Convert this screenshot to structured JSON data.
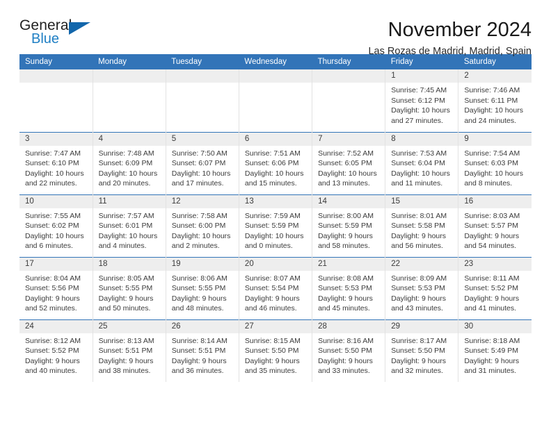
{
  "brand": {
    "name_top": "General",
    "name_bottom": "Blue",
    "accent_color": "#1266ab",
    "blue_text_color": "#1f7fc4",
    "triangle_icon": "triangle-icon"
  },
  "header": {
    "title": "November 2024",
    "subtitle": "Las Rozas de Madrid, Madrid, Spain"
  },
  "calendar": {
    "header_bg": "#3274b8",
    "daynum_bg": "#eeeeee",
    "weekday_labels": [
      "Sunday",
      "Monday",
      "Tuesday",
      "Wednesday",
      "Thursday",
      "Friday",
      "Saturday"
    ],
    "labels": {
      "sunrise": "Sunrise:",
      "sunset": "Sunset:",
      "daylight": "Daylight:"
    },
    "weeks": [
      [
        {
          "day": ""
        },
        {
          "day": ""
        },
        {
          "day": ""
        },
        {
          "day": ""
        },
        {
          "day": ""
        },
        {
          "day": "1",
          "sunrise": "Sunrise: 7:45 AM",
          "sunset": "Sunset: 6:12 PM",
          "daylight_1": "Daylight: 10 hours",
          "daylight_2": "and 27 minutes."
        },
        {
          "day": "2",
          "sunrise": "Sunrise: 7:46 AM",
          "sunset": "Sunset: 6:11 PM",
          "daylight_1": "Daylight: 10 hours",
          "daylight_2": "and 24 minutes."
        }
      ],
      [
        {
          "day": "3",
          "sunrise": "Sunrise: 7:47 AM",
          "sunset": "Sunset: 6:10 PM",
          "daylight_1": "Daylight: 10 hours",
          "daylight_2": "and 22 minutes."
        },
        {
          "day": "4",
          "sunrise": "Sunrise: 7:48 AM",
          "sunset": "Sunset: 6:09 PM",
          "daylight_1": "Daylight: 10 hours",
          "daylight_2": "and 20 minutes."
        },
        {
          "day": "5",
          "sunrise": "Sunrise: 7:50 AM",
          "sunset": "Sunset: 6:07 PM",
          "daylight_1": "Daylight: 10 hours",
          "daylight_2": "and 17 minutes."
        },
        {
          "day": "6",
          "sunrise": "Sunrise: 7:51 AM",
          "sunset": "Sunset: 6:06 PM",
          "daylight_1": "Daylight: 10 hours",
          "daylight_2": "and 15 minutes."
        },
        {
          "day": "7",
          "sunrise": "Sunrise: 7:52 AM",
          "sunset": "Sunset: 6:05 PM",
          "daylight_1": "Daylight: 10 hours",
          "daylight_2": "and 13 minutes."
        },
        {
          "day": "8",
          "sunrise": "Sunrise: 7:53 AM",
          "sunset": "Sunset: 6:04 PM",
          "daylight_1": "Daylight: 10 hours",
          "daylight_2": "and 11 minutes."
        },
        {
          "day": "9",
          "sunrise": "Sunrise: 7:54 AM",
          "sunset": "Sunset: 6:03 PM",
          "daylight_1": "Daylight: 10 hours",
          "daylight_2": "and 8 minutes."
        }
      ],
      [
        {
          "day": "10",
          "sunrise": "Sunrise: 7:55 AM",
          "sunset": "Sunset: 6:02 PM",
          "daylight_1": "Daylight: 10 hours",
          "daylight_2": "and 6 minutes."
        },
        {
          "day": "11",
          "sunrise": "Sunrise: 7:57 AM",
          "sunset": "Sunset: 6:01 PM",
          "daylight_1": "Daylight: 10 hours",
          "daylight_2": "and 4 minutes."
        },
        {
          "day": "12",
          "sunrise": "Sunrise: 7:58 AM",
          "sunset": "Sunset: 6:00 PM",
          "daylight_1": "Daylight: 10 hours",
          "daylight_2": "and 2 minutes."
        },
        {
          "day": "13",
          "sunrise": "Sunrise: 7:59 AM",
          "sunset": "Sunset: 5:59 PM",
          "daylight_1": "Daylight: 10 hours",
          "daylight_2": "and 0 minutes."
        },
        {
          "day": "14",
          "sunrise": "Sunrise: 8:00 AM",
          "sunset": "Sunset: 5:59 PM",
          "daylight_1": "Daylight: 9 hours",
          "daylight_2": "and 58 minutes."
        },
        {
          "day": "15",
          "sunrise": "Sunrise: 8:01 AM",
          "sunset": "Sunset: 5:58 PM",
          "daylight_1": "Daylight: 9 hours",
          "daylight_2": "and 56 minutes."
        },
        {
          "day": "16",
          "sunrise": "Sunrise: 8:03 AM",
          "sunset": "Sunset: 5:57 PM",
          "daylight_1": "Daylight: 9 hours",
          "daylight_2": "and 54 minutes."
        }
      ],
      [
        {
          "day": "17",
          "sunrise": "Sunrise: 8:04 AM",
          "sunset": "Sunset: 5:56 PM",
          "daylight_1": "Daylight: 9 hours",
          "daylight_2": "and 52 minutes."
        },
        {
          "day": "18",
          "sunrise": "Sunrise: 8:05 AM",
          "sunset": "Sunset: 5:55 PM",
          "daylight_1": "Daylight: 9 hours",
          "daylight_2": "and 50 minutes."
        },
        {
          "day": "19",
          "sunrise": "Sunrise: 8:06 AM",
          "sunset": "Sunset: 5:55 PM",
          "daylight_1": "Daylight: 9 hours",
          "daylight_2": "and 48 minutes."
        },
        {
          "day": "20",
          "sunrise": "Sunrise: 8:07 AM",
          "sunset": "Sunset: 5:54 PM",
          "daylight_1": "Daylight: 9 hours",
          "daylight_2": "and 46 minutes."
        },
        {
          "day": "21",
          "sunrise": "Sunrise: 8:08 AM",
          "sunset": "Sunset: 5:53 PM",
          "daylight_1": "Daylight: 9 hours",
          "daylight_2": "and 45 minutes."
        },
        {
          "day": "22",
          "sunrise": "Sunrise: 8:09 AM",
          "sunset": "Sunset: 5:53 PM",
          "daylight_1": "Daylight: 9 hours",
          "daylight_2": "and 43 minutes."
        },
        {
          "day": "23",
          "sunrise": "Sunrise: 8:11 AM",
          "sunset": "Sunset: 5:52 PM",
          "daylight_1": "Daylight: 9 hours",
          "daylight_2": "and 41 minutes."
        }
      ],
      [
        {
          "day": "24",
          "sunrise": "Sunrise: 8:12 AM",
          "sunset": "Sunset: 5:52 PM",
          "daylight_1": "Daylight: 9 hours",
          "daylight_2": "and 40 minutes."
        },
        {
          "day": "25",
          "sunrise": "Sunrise: 8:13 AM",
          "sunset": "Sunset: 5:51 PM",
          "daylight_1": "Daylight: 9 hours",
          "daylight_2": "and 38 minutes."
        },
        {
          "day": "26",
          "sunrise": "Sunrise: 8:14 AM",
          "sunset": "Sunset: 5:51 PM",
          "daylight_1": "Daylight: 9 hours",
          "daylight_2": "and 36 minutes."
        },
        {
          "day": "27",
          "sunrise": "Sunrise: 8:15 AM",
          "sunset": "Sunset: 5:50 PM",
          "daylight_1": "Daylight: 9 hours",
          "daylight_2": "and 35 minutes."
        },
        {
          "day": "28",
          "sunrise": "Sunrise: 8:16 AM",
          "sunset": "Sunset: 5:50 PM",
          "daylight_1": "Daylight: 9 hours",
          "daylight_2": "and 33 minutes."
        },
        {
          "day": "29",
          "sunrise": "Sunrise: 8:17 AM",
          "sunset": "Sunset: 5:50 PM",
          "daylight_1": "Daylight: 9 hours",
          "daylight_2": "and 32 minutes."
        },
        {
          "day": "30",
          "sunrise": "Sunrise: 8:18 AM",
          "sunset": "Sunset: 5:49 PM",
          "daylight_1": "Daylight: 9 hours",
          "daylight_2": "and 31 minutes."
        }
      ]
    ]
  }
}
